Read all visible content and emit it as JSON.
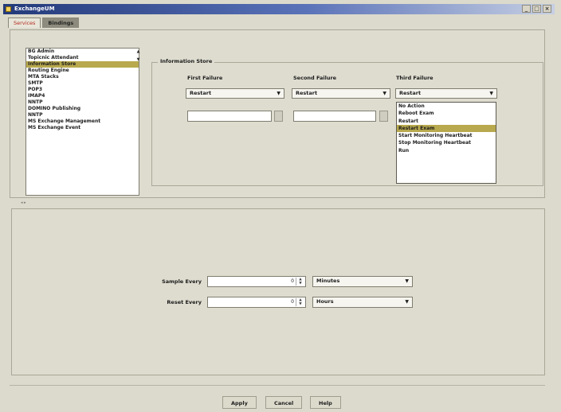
{
  "window": {
    "title": "ExchangeUM",
    "buttons": [
      "_",
      "□",
      "×"
    ]
  },
  "tabs": [
    {
      "label": "Services"
    },
    {
      "label": "Bindings"
    }
  ],
  "services": [
    "BG Admin",
    "Topicnic Attendant",
    "Information Store",
    "Routing Engine",
    "MTA Stacks",
    "SMTP",
    "POP3",
    "IMAP4",
    "NNTP",
    "DOMINO Publishing",
    "NNTP",
    "MS Exchange Management",
    "MS Exchange Event"
  ],
  "services_selected_index": 2,
  "recovery": {
    "group_title": "Information Store",
    "first_label": "First Failure",
    "second_label": "Second Failure",
    "third_label": "Third Failure",
    "first_value": "Restart",
    "second_value": "Restart",
    "third_value": "Restart",
    "first_field": "",
    "second_field": "",
    "third_options": [
      "No Action",
      "Reboot Exam",
      "Restart",
      "Restart Exam",
      "Start Monitoring Heartbeat",
      "Stop Monitoring Heartbeat",
      "Run"
    ],
    "third_highlight_index": 3
  },
  "schedule": {
    "sample_label": "Sample Every",
    "sample_value": "0",
    "sample_unit": "Minutes",
    "reset_label": "Reset Every",
    "reset_value": "0",
    "reset_unit": "Hours"
  },
  "actions": {
    "apply": "Apply",
    "cancel": "Cancel",
    "help": "Help"
  }
}
